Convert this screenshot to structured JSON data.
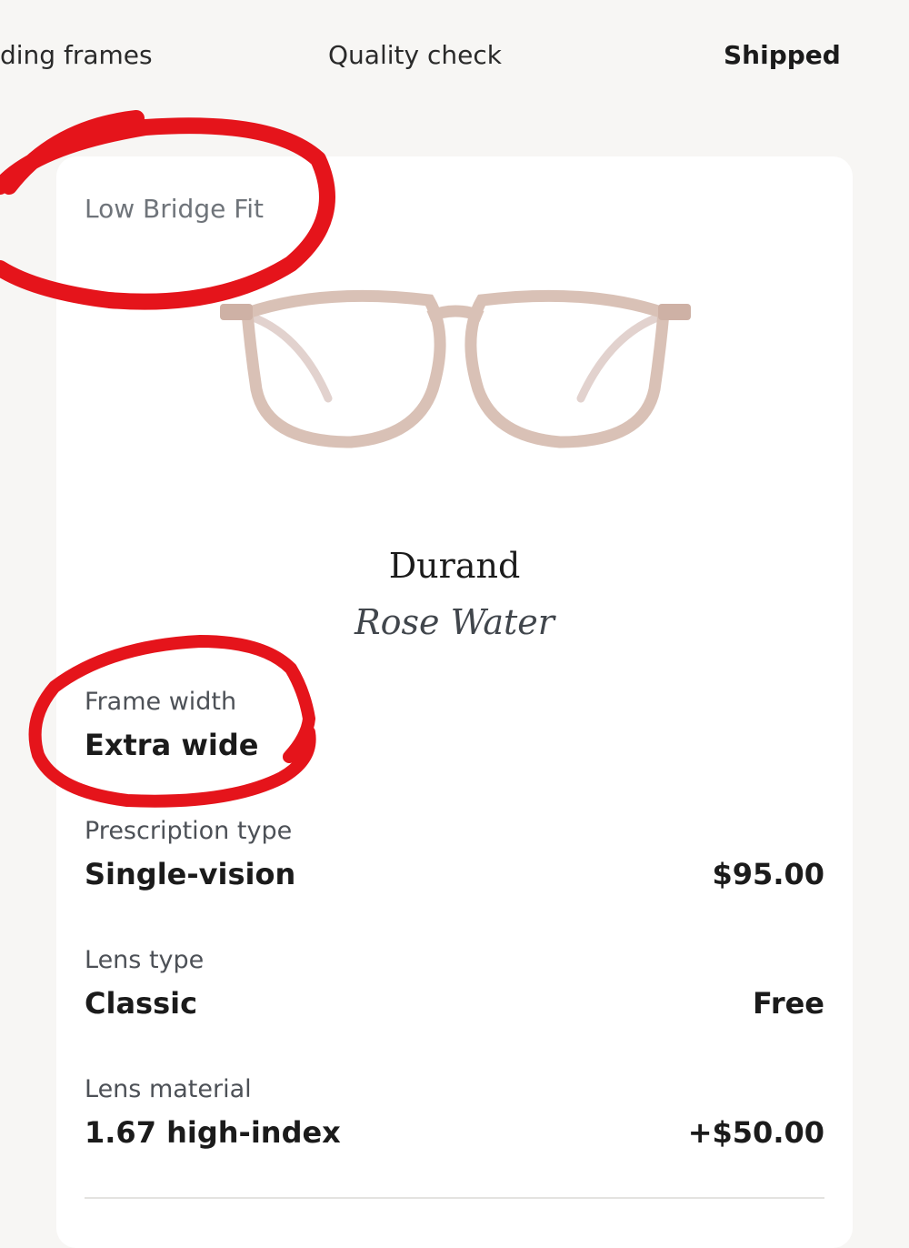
{
  "progress_steps": [
    {
      "label": "ding frames"
    },
    {
      "label": "Quality check"
    },
    {
      "label": "Shipped"
    }
  ],
  "product": {
    "fit": "Low Bridge Fit",
    "name": "Durand",
    "color_name": "Rose Water"
  },
  "details": {
    "frame_width": {
      "label": "Frame width",
      "value": "Extra wide"
    },
    "prescription_type": {
      "label": "Prescription type",
      "value": "Single-vision",
      "price": "$95.00"
    },
    "lens_type": {
      "label": "Lens type",
      "value": "Classic",
      "price": "Free"
    },
    "lens_material": {
      "label": "Lens material",
      "value": "1.67 high-index",
      "price": "+$50.00"
    }
  },
  "colors": {
    "frame_tint": "#d9c1b6",
    "annotation": "#e5141b"
  }
}
